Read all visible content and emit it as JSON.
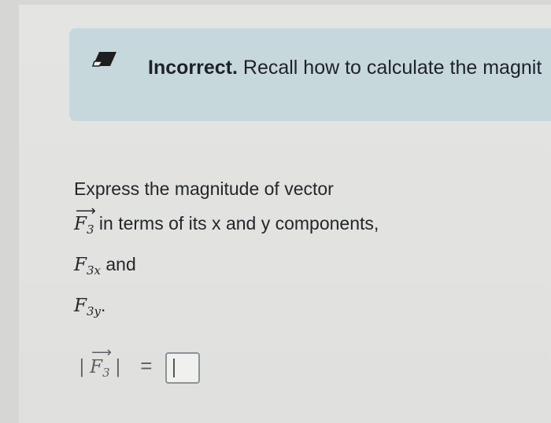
{
  "feedback": {
    "strong": "Incorrect.",
    "message": "Recall how to calculate the magnit"
  },
  "question": {
    "line1": "Express the magnitude of vector",
    "vector_symbol": "F",
    "vector_subscript": "3",
    "line2_text": "in terms of its x and y components,",
    "comp_x_symbol": "F",
    "comp_x_subscript": "3x",
    "and_text": "and",
    "comp_y_symbol": "F",
    "comp_y_subscript": "3y",
    "period": "."
  },
  "answer": {
    "abs_open": "|",
    "vector_symbol": "F",
    "vector_subscript": "3",
    "abs_close": "|",
    "equals": "=",
    "value": ""
  },
  "icons": {
    "feedback": "eraser-icon"
  }
}
